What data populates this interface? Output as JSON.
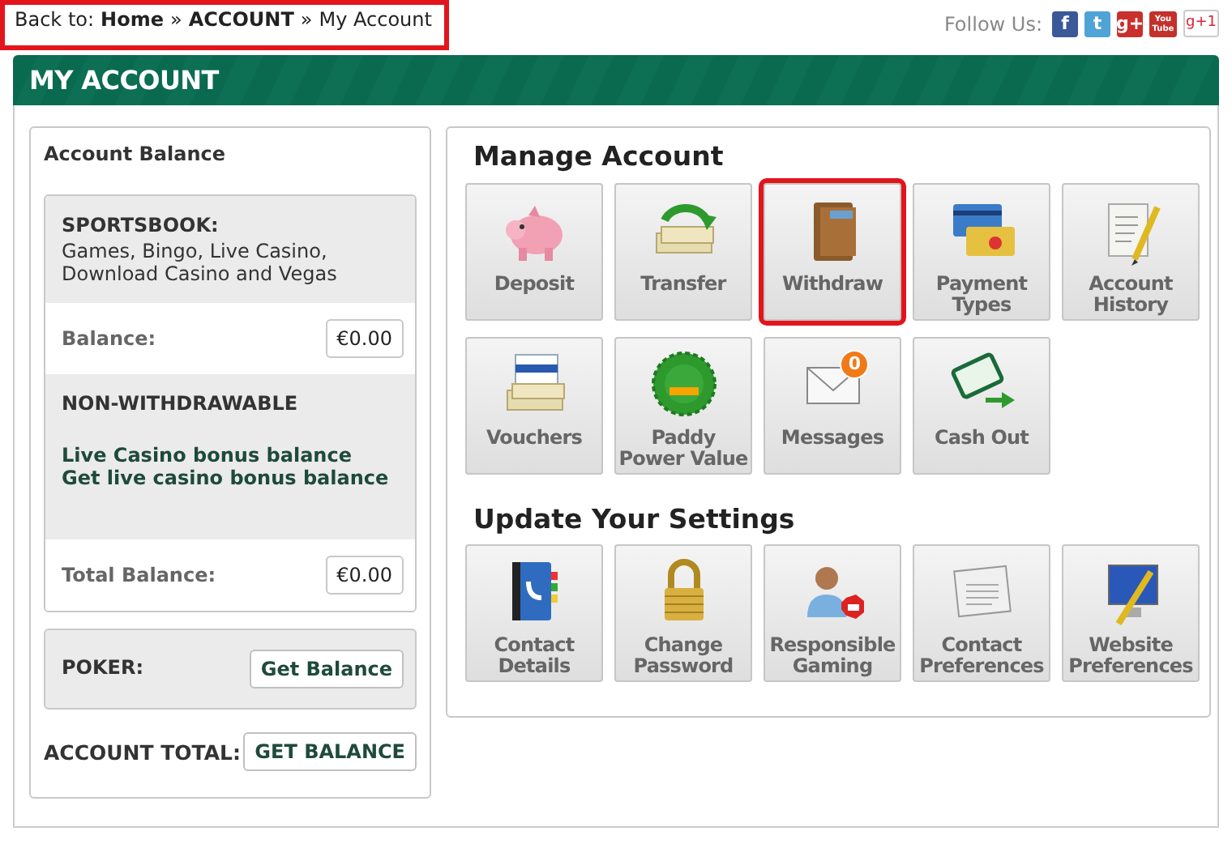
{
  "breadcrumb": {
    "prefix": "Back to:",
    "items": [
      {
        "text": "Home",
        "link": true
      },
      {
        "text": "ACCOUNT",
        "link": true
      },
      {
        "text": "My Account",
        "link": false
      }
    ],
    "separators": [
      "»",
      "»"
    ],
    "highlighted": true
  },
  "follow": {
    "label": "Follow Us:",
    "icons": [
      {
        "text": "f",
        "color": "#3b5998"
      },
      {
        "text": "t",
        "color": "#4fa3d6"
      },
      {
        "text": "g+",
        "color": "#c9302c"
      },
      {
        "text": "You Tube",
        "color": "#c4302b"
      },
      {
        "text": "g+1",
        "color": "#ffffff"
      }
    ]
  },
  "header": {
    "title": "MY ACCOUNT"
  },
  "balance": {
    "title": "Account Balance",
    "sportsbook": {
      "heading": "SPORTSBOOK:",
      "description": "Games, Bingo, Live Casino, Download Casino and Vegas"
    },
    "balance_row": {
      "label": "Balance:",
      "value": "€0.00"
    },
    "non_withdrawable": {
      "heading": "NON-WITHDRAWABLE",
      "links": [
        "Live Casino bonus balance",
        "Get live casino bonus balance"
      ]
    },
    "total_row": {
      "label": "Total Balance:",
      "value": "€0.00"
    },
    "poker": {
      "label": "POKER:",
      "button": "Get Balance"
    },
    "account_total": {
      "label": "ACCOUNT TOTAL:",
      "button": "GET BALANCE"
    }
  },
  "sections": [
    {
      "title": "Manage Account",
      "tiles": [
        {
          "label": "Deposit",
          "highlighted": false
        },
        {
          "label": "Transfer",
          "highlighted": false
        },
        {
          "label": "Withdraw",
          "highlighted": true
        },
        {
          "label": "Payment Types",
          "highlighted": false
        },
        {
          "label": "Account History",
          "highlighted": false
        },
        {
          "label": "Vouchers",
          "highlighted": false
        },
        {
          "label": "Paddy Power Value",
          "highlighted": false
        },
        {
          "label": "Messages",
          "highlighted": false,
          "badge": "0"
        },
        {
          "label": "Cash Out",
          "highlighted": false
        }
      ]
    },
    {
      "title": "Update Your Settings",
      "tiles": [
        {
          "label": "Contact Details",
          "highlighted": false
        },
        {
          "label": "Change Password",
          "highlighted": false
        },
        {
          "label": "Responsible Gaming",
          "highlighted": false
        },
        {
          "label": "Contact Preferences",
          "highlighted": false
        },
        {
          "label": "Website Preferences",
          "highlighted": false
        }
      ]
    }
  ]
}
